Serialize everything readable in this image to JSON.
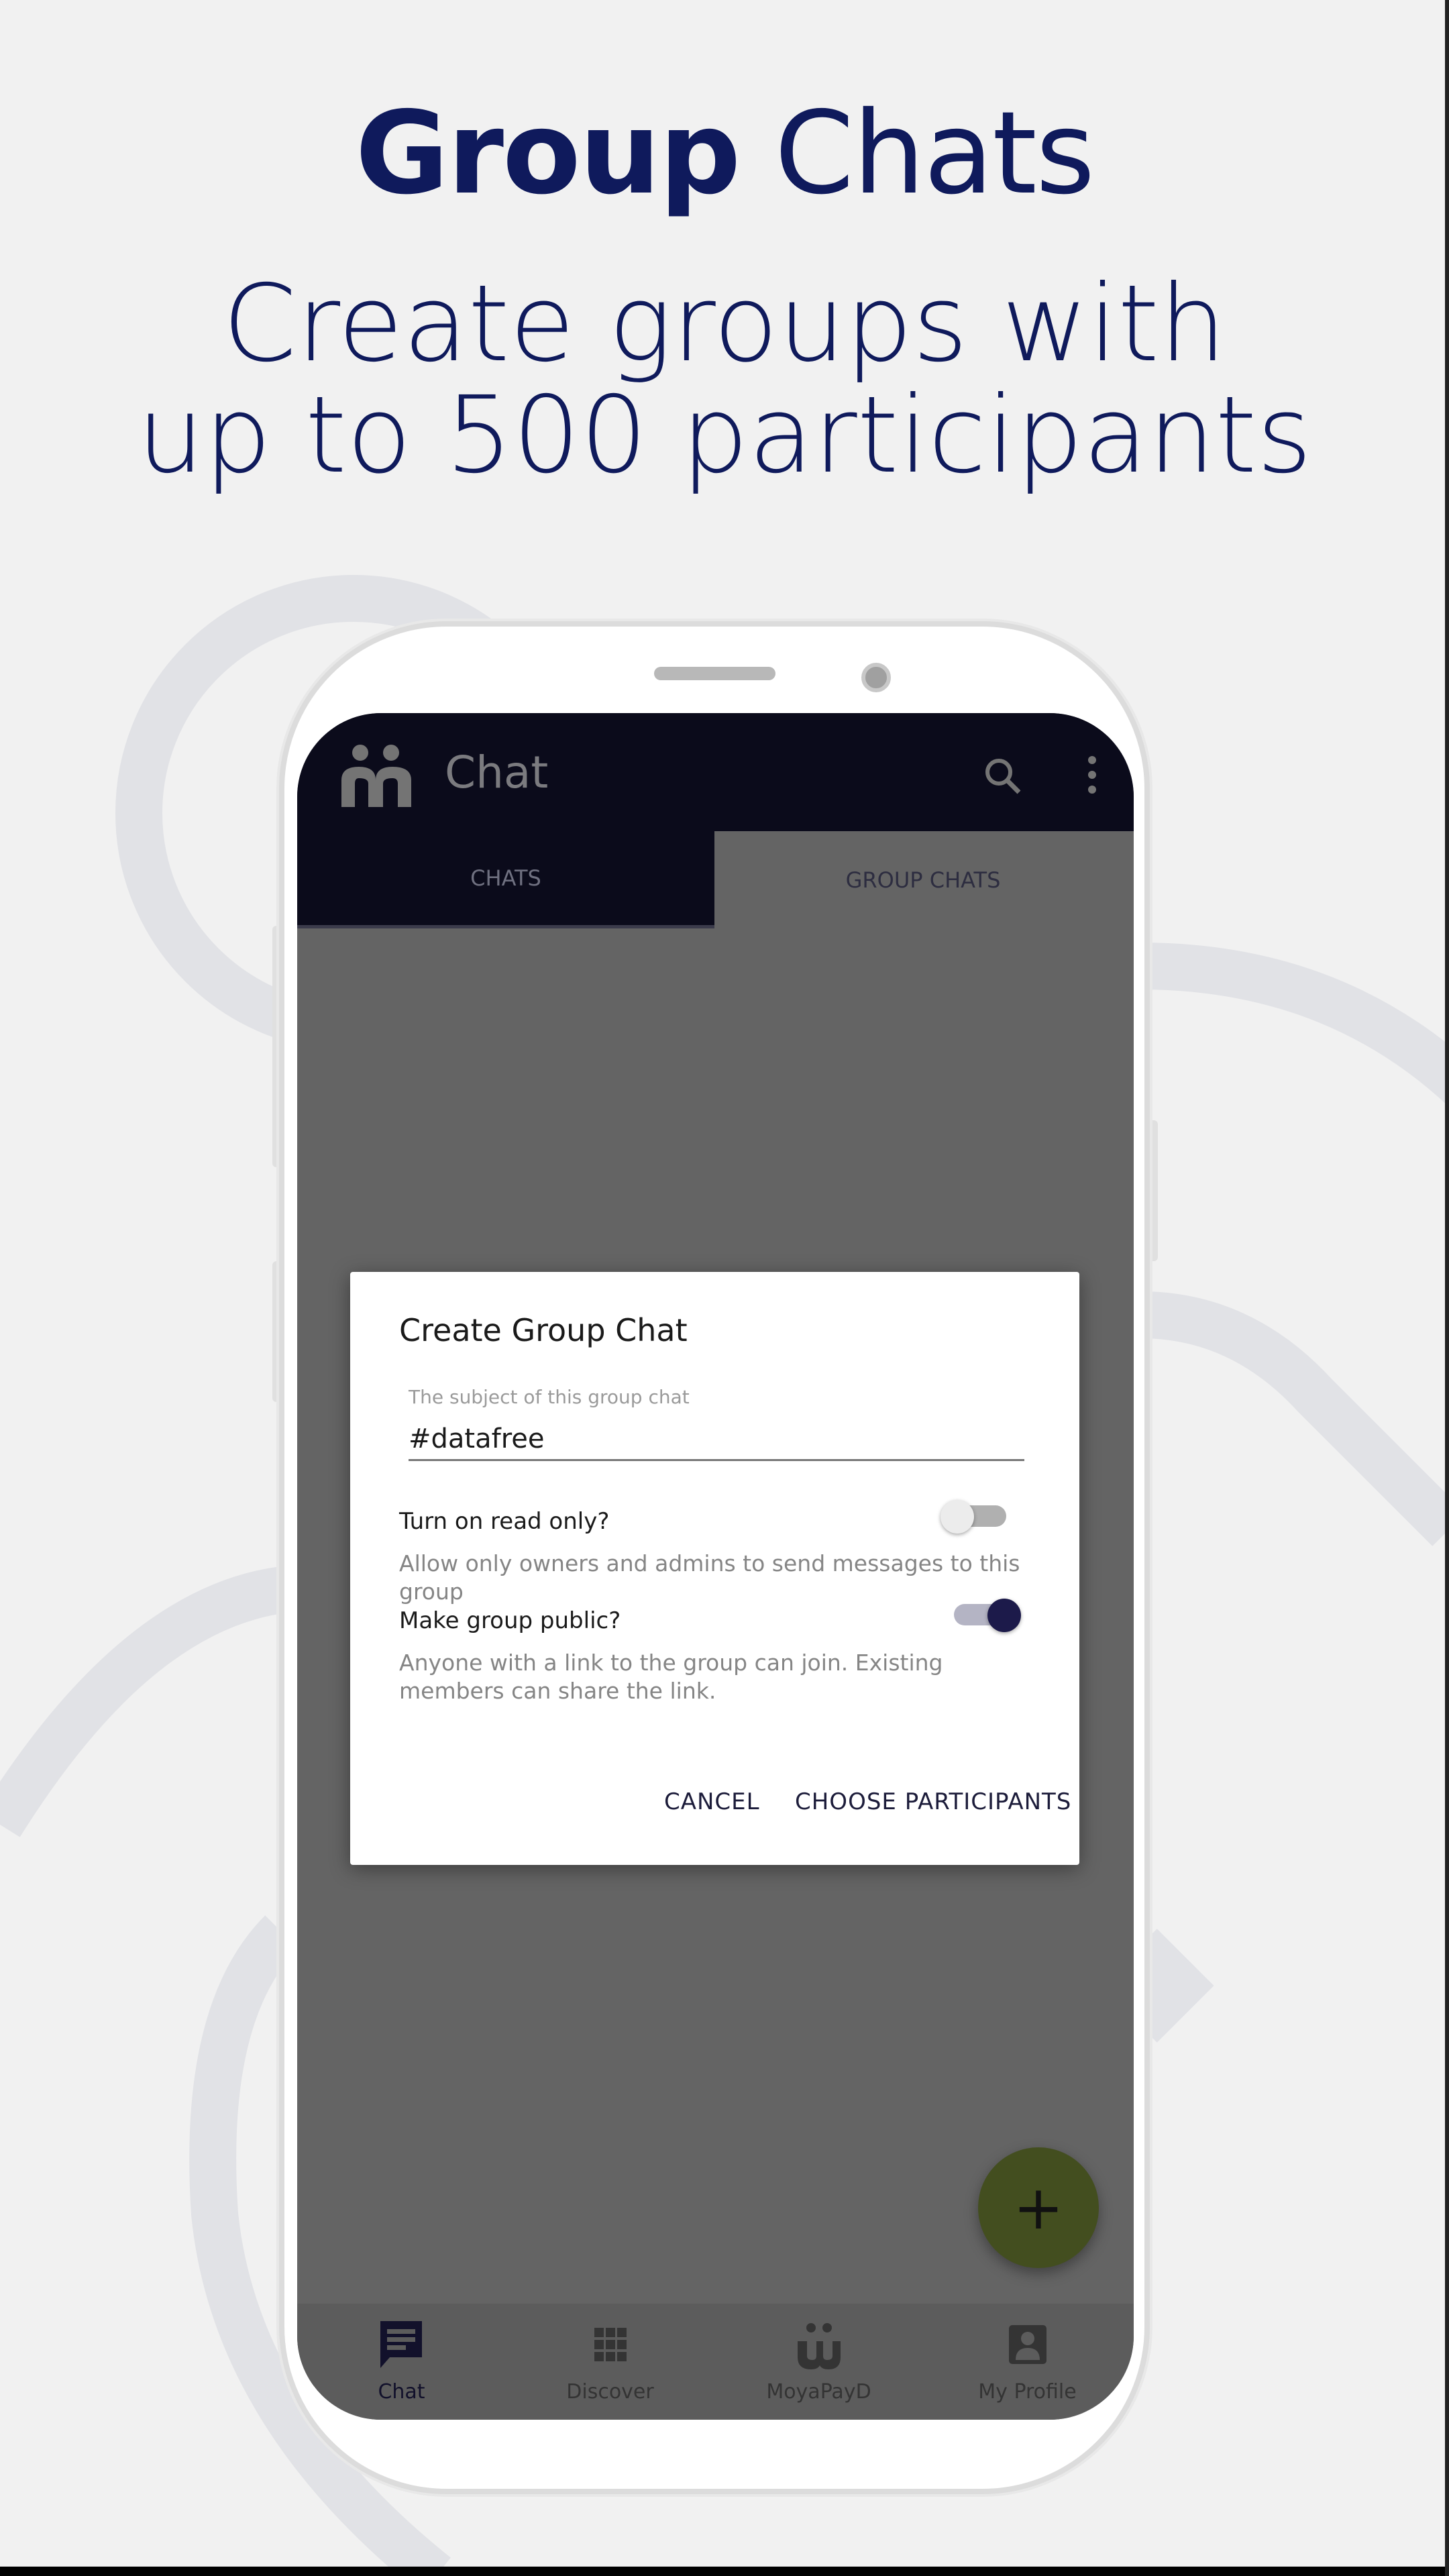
{
  "headline": {
    "title_bold": "Group",
    "title_light": "Chats",
    "subtitle_line1": "Create groups with",
    "subtitle_line2": "up to 500 participants"
  },
  "colors": {
    "headline": "#0f1a5c",
    "appbar": "#0b0b1b",
    "fab": "#434e1f",
    "toggle_on": "#1c1a4a"
  },
  "app": {
    "title": "Chat",
    "tabs": [
      {
        "label": "CHATS",
        "selected": false
      },
      {
        "label": "GROUP CHATS",
        "selected": true
      }
    ]
  },
  "dialog": {
    "title": "Create Group Chat",
    "subject_label": "The subject of this group chat",
    "subject_value": "#datafree",
    "read_only": {
      "label": "Turn on read only?",
      "description": "Allow only owners and admins to send messages to this group",
      "on": false
    },
    "public": {
      "label": "Make group public?",
      "description": "Anyone with a link to the group can join. Existing members can share the link.",
      "on": true
    },
    "cancel": "CANCEL",
    "confirm": "CHOOSE PARTICIPANTS"
  },
  "fab": {
    "label": "+",
    "icon": "plus-icon"
  },
  "nav": [
    {
      "label": "Chat",
      "icon": "chat-icon",
      "active": true
    },
    {
      "label": "Discover",
      "icon": "grid-icon"
    },
    {
      "label": "MoyaPayD",
      "icon": "moya-icon"
    },
    {
      "label": "My Profile",
      "icon": "profile-icon"
    }
  ]
}
